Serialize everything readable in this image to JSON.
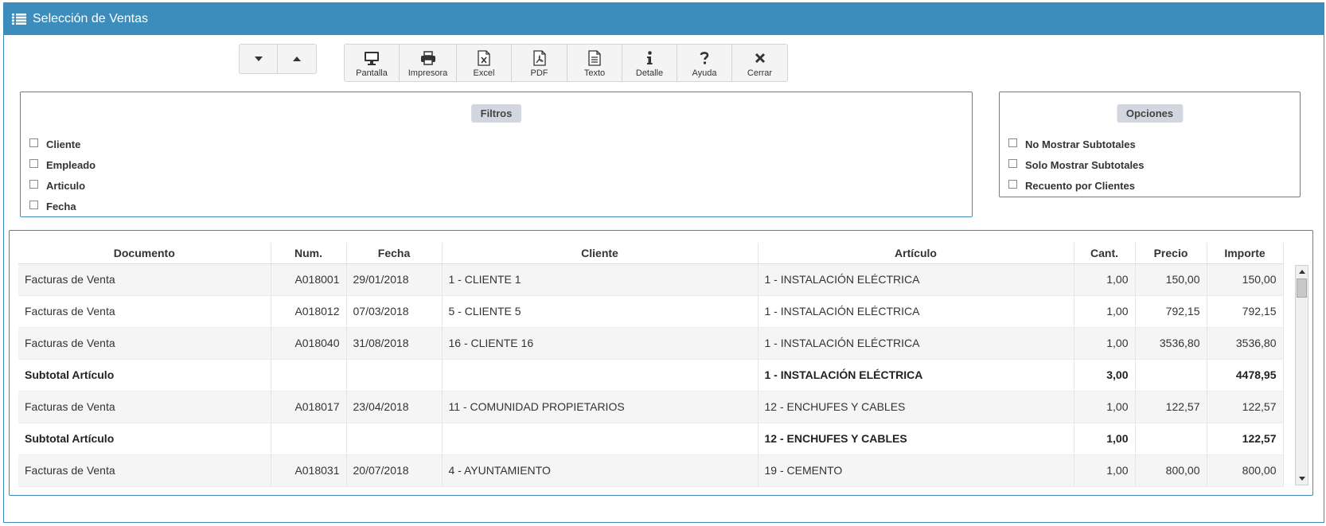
{
  "window": {
    "title": "Selección de Ventas"
  },
  "toolbar": {
    "buttons": [
      {
        "label": "Pantalla",
        "icon": "monitor-icon"
      },
      {
        "label": "Impresora",
        "icon": "printer-icon"
      },
      {
        "label": "Excel",
        "icon": "excel-icon"
      },
      {
        "label": "PDF",
        "icon": "pdf-icon"
      },
      {
        "label": "Texto",
        "icon": "text-file-icon"
      },
      {
        "label": "Detalle",
        "icon": "info-icon"
      },
      {
        "label": "Ayuda",
        "icon": "question-icon"
      },
      {
        "label": "Cerrar",
        "icon": "close-icon"
      }
    ]
  },
  "filters": {
    "title": "Filtros",
    "items": [
      "Cliente",
      "Empleado",
      "Articulo",
      "Fecha"
    ]
  },
  "options": {
    "title": "Opciones",
    "items": [
      "No Mostrar Subtotales",
      "Solo Mostrar Subtotales",
      "Recuento por Clientes"
    ]
  },
  "table": {
    "columns": [
      "Documento",
      "Num.",
      "Fecha",
      "Cliente",
      "Artículo",
      "Cant.",
      "Precio",
      "Importe"
    ],
    "rows": [
      [
        "Facturas de Venta",
        "A018001",
        "29/01/2018",
        "1 - CLIENTE 1",
        "1 - INSTALACIÓN ELÉCTRICA",
        "1,00",
        "150,00",
        "150,00"
      ],
      [
        "Facturas de Venta",
        "A018012",
        "07/03/2018",
        "5 - CLIENTE 5",
        "1 - INSTALACIÓN ELÉCTRICA",
        "1,00",
        "792,15",
        "792,15"
      ],
      [
        "Facturas de Venta",
        "A018040",
        "31/08/2018",
        "16 - CLIENTE 16",
        "1 - INSTALACIÓN ELÉCTRICA",
        "1,00",
        "3536,80",
        "3536,80"
      ],
      [
        "Subtotal Artículo",
        "",
        "",
        "",
        "1 - INSTALACIÓN ELÉCTRICA",
        "3,00",
        "",
        "4478,95"
      ],
      [
        "Facturas de Venta",
        "A018017",
        "23/04/2018",
        "11 - COMUNIDAD PROPIETARIOS",
        "12 - ENCHUFES Y CABLES",
        "1,00",
        "122,57",
        "122,57"
      ],
      [
        "Subtotal Artículo",
        "",
        "",
        "",
        "12 - ENCHUFES Y CABLES",
        "1,00",
        "",
        "122,57"
      ],
      [
        "Facturas de Venta",
        "A018031",
        "20/07/2018",
        "4 - AYUNTAMIENTO",
        "19 - CEMENTO",
        "1,00",
        "800,00",
        "800,00"
      ]
    ],
    "subtotal_rows": [
      3,
      5
    ]
  }
}
